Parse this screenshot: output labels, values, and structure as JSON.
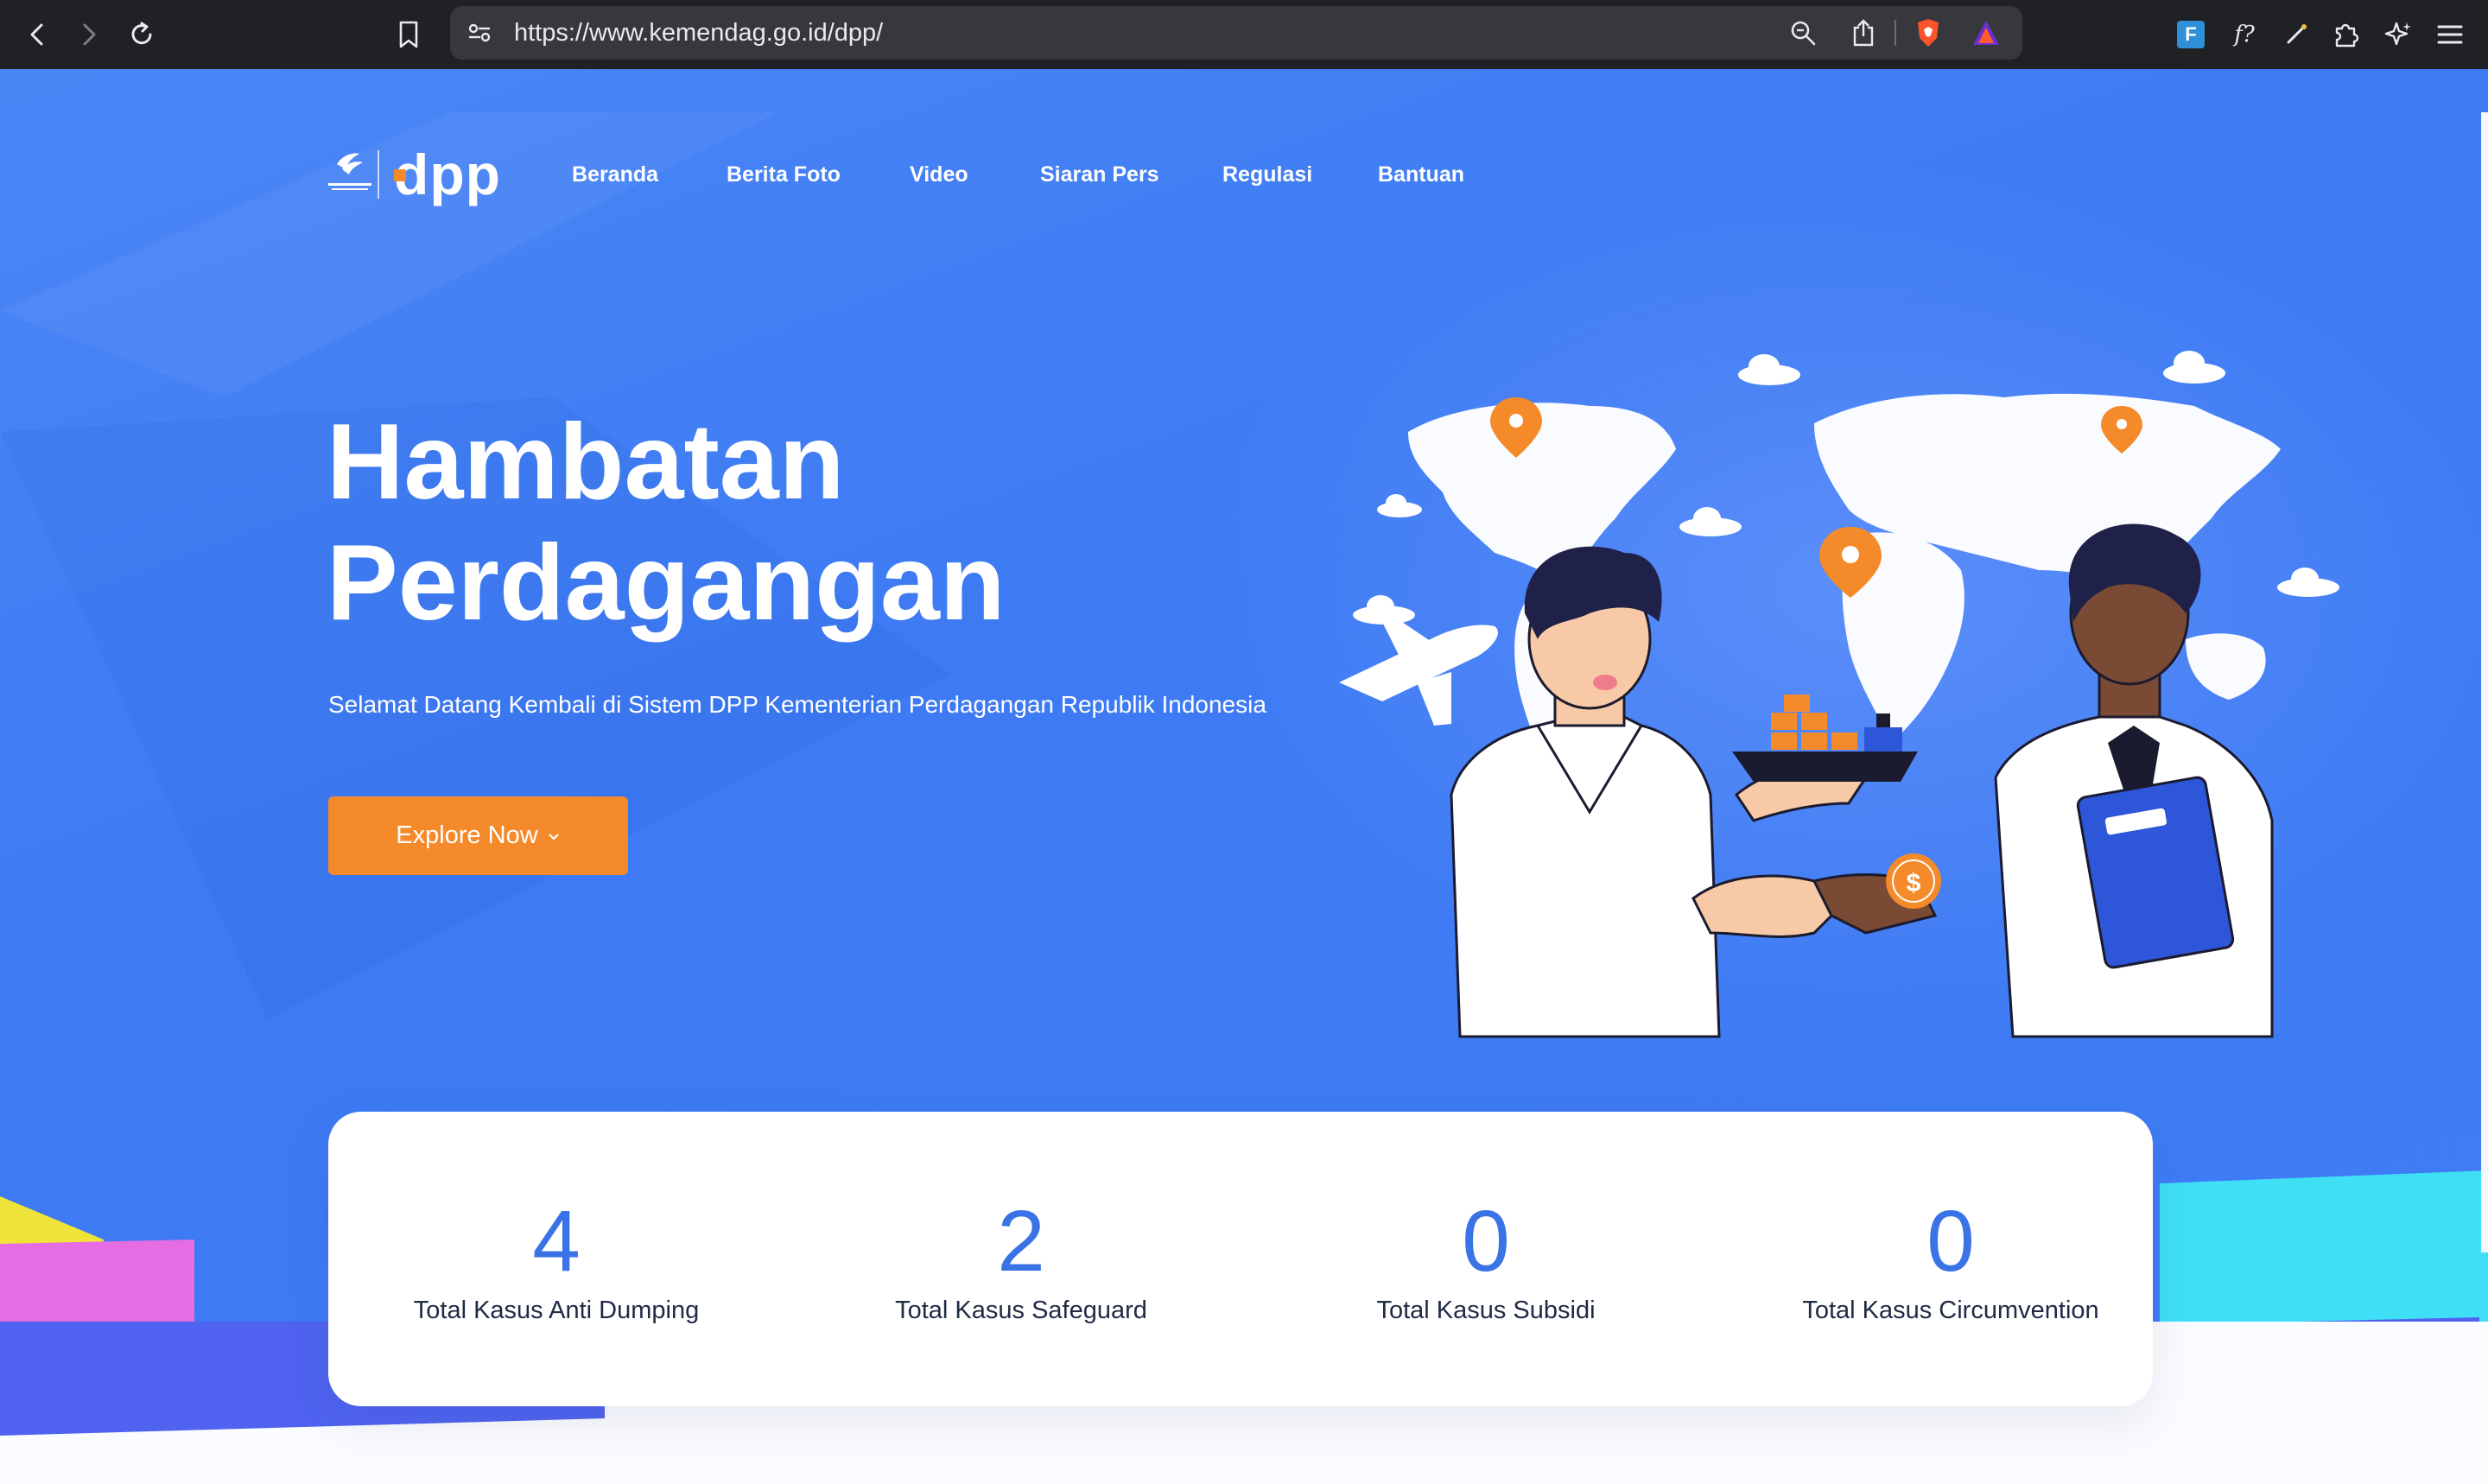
{
  "browser": {
    "url": "https://www.kemendag.go.id/dpp/"
  },
  "nav": {
    "logo_text": "dpp",
    "items": [
      {
        "label": "Beranda"
      },
      {
        "label": "Berita Foto"
      },
      {
        "label": "Video"
      },
      {
        "label": "Siaran Pers"
      },
      {
        "label": "Regulasi"
      },
      {
        "label": "Bantuan"
      }
    ]
  },
  "hero": {
    "title_line1": "Hambatan",
    "title_line2": "Perdagangan",
    "subtitle": "Selamat Datang Kembali di Sistem DPP Kementerian Perdagangan Republik Indonesia",
    "button_label": "Explore Now",
    "dollar_symbol": "$"
  },
  "stats": [
    {
      "value": "4",
      "label": "Total Kasus Anti Dumping"
    },
    {
      "value": "2",
      "label": "Total Kasus Safeguard"
    },
    {
      "value": "0",
      "label": "Total Kasus Subsidi"
    },
    {
      "value": "0",
      "label": "Total Kasus Circumvention"
    }
  ],
  "extensions": {
    "ext1_text": "F",
    "ext2_text": "f?"
  },
  "colors": {
    "hero_blue": "#3f7cf5",
    "accent_orange": "#f58a2a",
    "stat_number": "#3a73e6"
  }
}
